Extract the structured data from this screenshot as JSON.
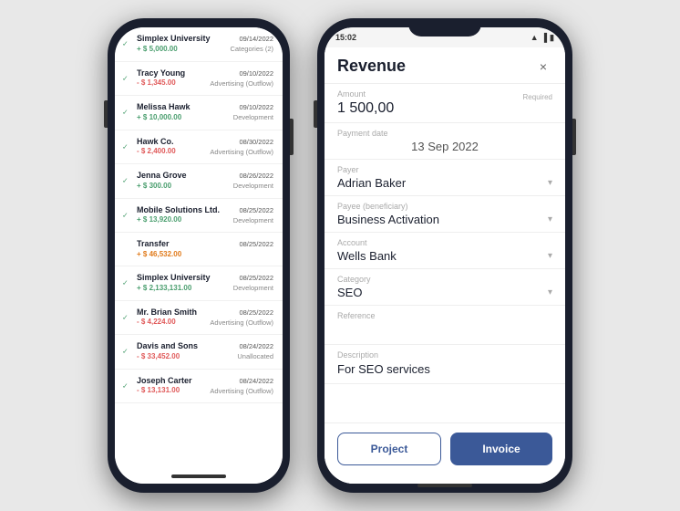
{
  "leftPhone": {
    "transactions": [
      {
        "name": "Simplex University",
        "amount": "+ $ 5,000.00",
        "amountType": "positive",
        "date": "09/14/2022",
        "category": "Categories (2)",
        "hasCheck": true
      },
      {
        "name": "Tracy Young",
        "amount": "- $ 1,345.00",
        "amountType": "negative",
        "date": "09/10/2022",
        "category": "Advertising (Outflow)",
        "hasCheck": true
      },
      {
        "name": "Melissa Hawk",
        "amount": "+ $ 10,000.00",
        "amountType": "positive",
        "date": "09/10/2022",
        "category": "Development",
        "hasCheck": true
      },
      {
        "name": "Hawk Co.",
        "amount": "- $ 2,400.00",
        "amountType": "negative",
        "date": "08/30/2022",
        "category": "Advertising (Outflow)",
        "hasCheck": true
      },
      {
        "name": "Jenna Grove",
        "amount": "+ $ 300.00",
        "amountType": "positive",
        "date": "08/26/2022",
        "category": "Development",
        "hasCheck": true
      },
      {
        "name": "Mobile Solutions Ltd.",
        "amount": "+ $ 13,920.00",
        "amountType": "positive",
        "date": "08/25/2022",
        "category": "Development",
        "hasCheck": true
      },
      {
        "name": "Transfer",
        "amount": "+ $ 46,532.00",
        "amountType": "orange",
        "date": "08/25/2022",
        "category": "",
        "hasCheck": false
      },
      {
        "name": "Simplex University",
        "amount": "+ $ 2,133,131.00",
        "amountType": "positive",
        "date": "08/25/2022",
        "category": "Development",
        "hasCheck": true
      },
      {
        "name": "Mr. Brian Smith",
        "amount": "- $ 4,224.00",
        "amountType": "negative",
        "date": "08/25/2022",
        "category": "Advertising (Outflow)",
        "hasCheck": true
      },
      {
        "name": "Davis and Sons",
        "amount": "- $ 33,452.00",
        "amountType": "negative",
        "date": "08/24/2022",
        "category": "Unallocated",
        "hasCheck": true
      },
      {
        "name": "Joseph Carter",
        "amount": "- $ 13,131.00",
        "amountType": "negative",
        "date": "08/24/2022",
        "category": "Advertising (Outflow)",
        "hasCheck": true
      }
    ]
  },
  "rightPhone": {
    "statusTime": "15:02",
    "formTitle": "Revenue",
    "closeLabel": "×",
    "fields": {
      "amountLabel": "Amount",
      "amountValue": "1 500,00",
      "amountRequired": "Required",
      "paymentDateLabel": "Payment date",
      "paymentDateValue": "13 Sep 2022",
      "payerLabel": "Payer",
      "payerValue": "Adrian Baker",
      "payeeLabel": "Payee (beneficiary)",
      "payeeValue": "Business Activation",
      "accountLabel": "Account",
      "accountValue": "Wells Bank",
      "categoryLabel": "Category",
      "categoryValue": "SEO",
      "referenceLabel": "Reference",
      "referencePlaceholder": "",
      "descriptionLabel": "Description",
      "descriptionValue": "For SEO services"
    },
    "buttons": {
      "project": "Project",
      "invoice": "Invoice"
    }
  }
}
